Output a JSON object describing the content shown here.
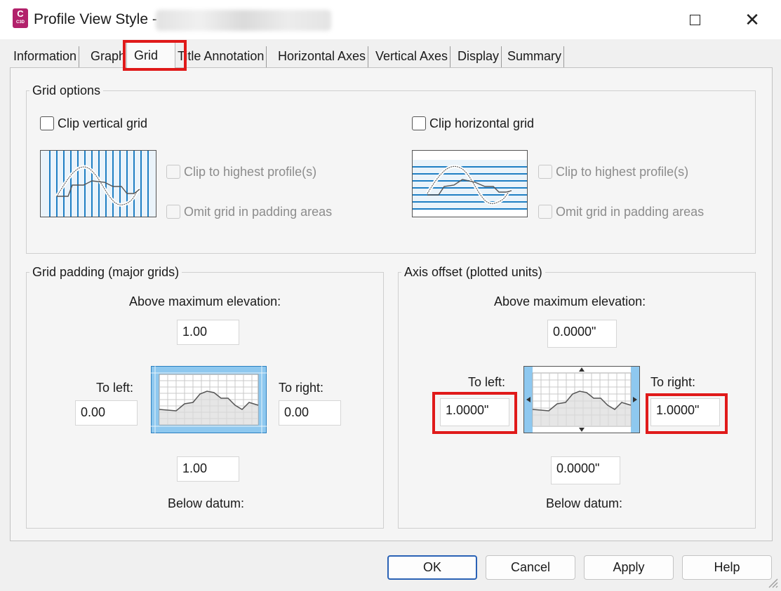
{
  "window": {
    "title": "Profile View Style -",
    "app_icon": {
      "letter": "C",
      "sub": "C3D"
    },
    "controls": {
      "maximize_icon": "maximize-icon",
      "close_symbol": "✕"
    }
  },
  "tabs": [
    {
      "label": "Information"
    },
    {
      "label": "Graph"
    },
    {
      "label": "Grid",
      "active": true
    },
    {
      "label": "Title Annotation"
    },
    {
      "label": "Horizontal Axes"
    },
    {
      "label": "Vertical Axes"
    },
    {
      "label": "Display"
    },
    {
      "label": "Summary"
    }
  ],
  "grid_options": {
    "label": "Grid options",
    "clip_vertical": {
      "label": "Clip vertical grid",
      "checked": false
    },
    "clip_horizontal": {
      "label": "Clip horizontal grid",
      "checked": false
    },
    "vertical_sub": {
      "clip_highest": "Clip to highest profile(s)",
      "omit_padding": "Omit grid in padding areas"
    },
    "horizontal_sub": {
      "clip_highest": "Clip to highest profile(s)",
      "omit_padding": "Omit grid in padding areas"
    }
  },
  "grid_padding": {
    "label": "Grid padding (major grids)",
    "above_label": "Above maximum elevation:",
    "above_value": "1.00",
    "left_label": "To left:",
    "left_value": "0.00",
    "right_label": "To right:",
    "right_value": "0.00",
    "below_value": "1.00",
    "below_label": "Below datum:"
  },
  "axis_offset": {
    "label": "Axis offset (plotted units)",
    "above_label": "Above maximum elevation:",
    "above_value": "0.0000\"",
    "left_label": "To left:",
    "left_value": "1.0000\"",
    "right_label": "To right:",
    "right_value": "1.0000\"",
    "below_value": "0.0000\"",
    "below_label": "Below datum:"
  },
  "buttons": {
    "ok": "OK",
    "cancel": "Cancel",
    "apply": "Apply",
    "help": "Help"
  },
  "colors": {
    "highlight": "#e01a1a",
    "grid_blue": "#1f7fc4",
    "padding_blue": "#8ec8ef",
    "default_button_border": "#2a62b5"
  }
}
